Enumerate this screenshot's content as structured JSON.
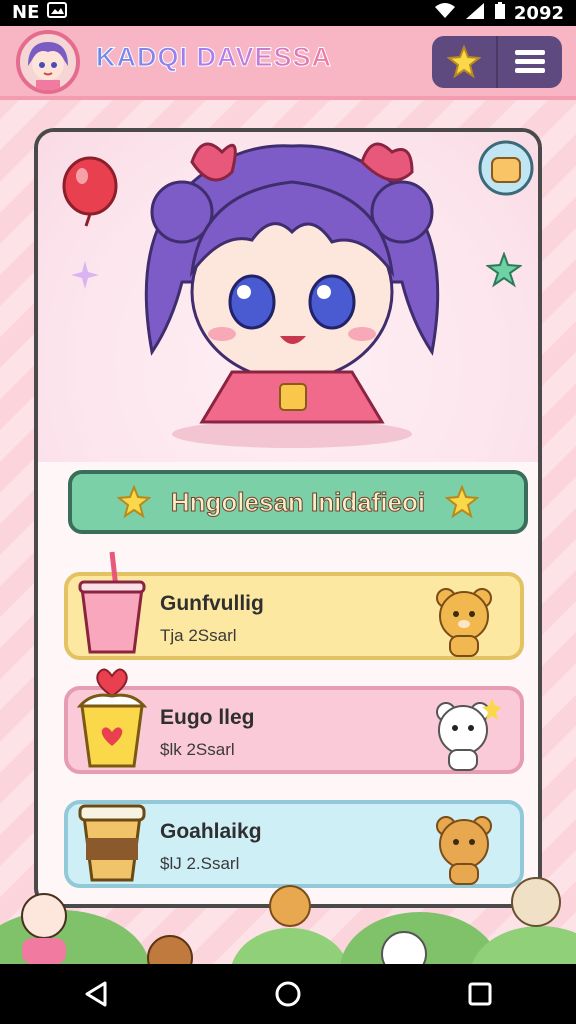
{
  "status_bar": {
    "carrier": "NE",
    "time": "2092"
  },
  "header": {
    "title": "KADQI DAVESSA",
    "avatar_icon": "chibi-avatar-icon",
    "star_button_icon": "star-icon",
    "menu_button_icon": "hamburger-menu-icon"
  },
  "banner": {
    "title": "Hngolesan Inidafieoi"
  },
  "items": [
    {
      "title": "Gunfvullig",
      "subtitle": "Tja 2Ssarl",
      "color": "#fde8a1"
    },
    {
      "title": "Eugo lleg",
      "subtitle": "$lk 2Ssarl",
      "color": "#fbcad9"
    },
    {
      "title": "Goahlaikg",
      "subtitle": "$lJ 2.Ssarl",
      "color": "#cfeff7"
    }
  ],
  "colors": {
    "header": "#f8b6c4",
    "banner": "#7bd0a8",
    "accent": "#e66c8f",
    "actions": "#5e4a7e"
  }
}
